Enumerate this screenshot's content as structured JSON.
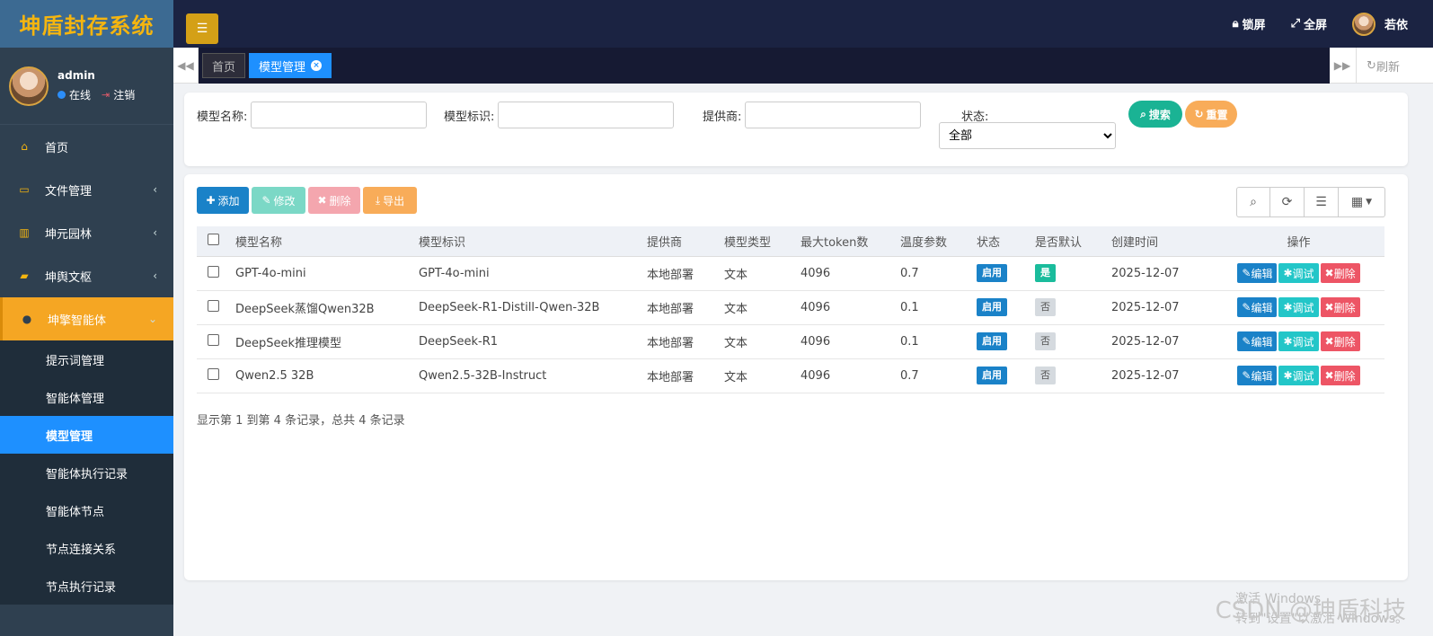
{
  "brand": {
    "title": "坤盾封存系统"
  },
  "user": {
    "name": "admin",
    "online": "在线",
    "logout": "注销"
  },
  "menu": [
    {
      "label": "首页",
      "icon": "home-icon",
      "glyph": "⌂",
      "chevron": ""
    },
    {
      "label": "文件管理",
      "icon": "card-icon",
      "glyph": "▭",
      "chevron": "‹"
    },
    {
      "label": "坤元园林",
      "icon": "bank-icon",
      "glyph": "▥",
      "chevron": "‹"
    },
    {
      "label": "坤舆文枢",
      "icon": "book-icon",
      "glyph": "▰",
      "chevron": "‹"
    },
    {
      "label": "坤擎智能体",
      "icon": "info-icon",
      "glyph": "●",
      "chevron": "⌄"
    }
  ],
  "submenu": [
    {
      "label": "提示词管理",
      "active": false
    },
    {
      "label": "智能体管理",
      "active": false
    },
    {
      "label": "模型管理",
      "active": true
    },
    {
      "label": "智能体执行记录",
      "active": false
    },
    {
      "label": "智能体节点",
      "active": false
    },
    {
      "label": "节点连接关系",
      "active": false
    },
    {
      "label": "节点执行记录",
      "active": false
    }
  ],
  "topbar": {
    "lock": "锁屏",
    "fullscreen": "全屏",
    "username": "若依"
  },
  "tabs": {
    "home": "首页",
    "current": "模型管理",
    "refresh": "刷新"
  },
  "search": {
    "name_label": "模型名称:",
    "id_label": "模型标识:",
    "provider_label": "提供商:",
    "status_label": "状态:",
    "status_value": "全部",
    "search_btn": "搜索",
    "reset_btn": "重置"
  },
  "toolbar": {
    "add": "添加",
    "edit": "修改",
    "delete": "删除",
    "export": "导出"
  },
  "table": {
    "headers": [
      "模型名称",
      "模型标识",
      "提供商",
      "模型类型",
      "最大token数",
      "温度参数",
      "状态",
      "是否默认",
      "创建时间",
      "操作"
    ],
    "rows": [
      {
        "name": "GPT-4o-mini",
        "ident": "GPT-4o-mini",
        "provider": "本地部署",
        "type": "文本",
        "tokens": "4096",
        "temp": "0.7",
        "status": "启用",
        "default": "是",
        "created": "2025-12-07"
      },
      {
        "name": "DeepSeek蒸馏Qwen32B",
        "ident": "DeepSeek-R1-Distill-Qwen-32B",
        "provider": "本地部署",
        "type": "文本",
        "tokens": "4096",
        "temp": "0.1",
        "status": "启用",
        "default": "否",
        "created": "2025-12-07"
      },
      {
        "name": "DeepSeek推理模型",
        "ident": "DeepSeek-R1",
        "provider": "本地部署",
        "type": "文本",
        "tokens": "4096",
        "temp": "0.1",
        "status": "启用",
        "default": "否",
        "created": "2025-12-07"
      },
      {
        "name": "Qwen2.5 32B",
        "ident": "Qwen2.5-32B-Instruct",
        "provider": "本地部署",
        "type": "文本",
        "tokens": "4096",
        "temp": "0.7",
        "status": "启用",
        "default": "否",
        "created": "2025-12-07"
      }
    ],
    "ops": {
      "edit": "编辑",
      "debug": "调试",
      "delete": "删除"
    }
  },
  "pager": {
    "text": "显示第 1 到第 4 条记录，总共 4 条记录"
  },
  "watermark": {
    "line1": "激活 Windows",
    "line2": "转到\"设置\"以激活 Windows。",
    "brand": "CSDN @坤盾科技"
  },
  "colors": {
    "sidebar": "#2f4050",
    "accent": "#f5a623",
    "primary": "#1e90ff",
    "topbar": "#1b2342"
  }
}
